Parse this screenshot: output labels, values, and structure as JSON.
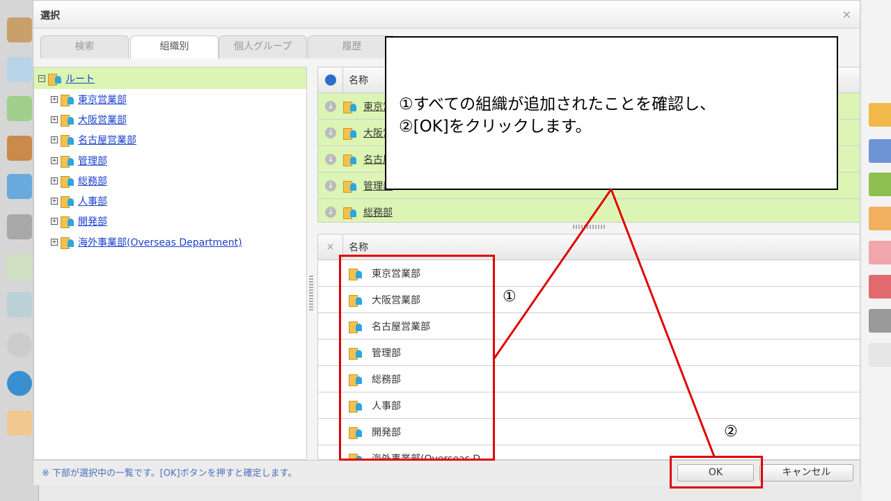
{
  "dialog": {
    "title": "選択",
    "close": "×"
  },
  "tabs": [
    {
      "label": "検索"
    },
    {
      "label": "組織別"
    },
    {
      "label": "個人グループ"
    },
    {
      "label": "履歴"
    }
  ],
  "tree": {
    "root": "ルート",
    "collapse": "−",
    "expand": "+",
    "nodes": [
      "東京営業部",
      "大阪営業部",
      "名古屋営業部",
      "管理部",
      "総務部",
      "人事部",
      "開発部",
      "海外事業部(Overseas Department)"
    ]
  },
  "upper_grid": {
    "header": "名称",
    "rows": [
      "東京営業部",
      "大阪営業部",
      "名古屋営業部",
      "管理部",
      "総務部"
    ]
  },
  "lower_grid": {
    "header": "名称",
    "remove": "×",
    "rows": [
      "東京営業部",
      "大阪営業部",
      "名古屋営業部",
      "管理部",
      "総務部",
      "人事部",
      "開発部",
      "海外事業部(Overseas D…"
    ]
  },
  "footer": {
    "text": "※ 下部が選択中の一覧です。[OK]ボタンを押すと確定します。",
    "ok": "OK",
    "cancel": "キャンセル"
  },
  "callout": {
    "line1": "①すべての組織が追加されたことを確認し、",
    "line2": "②[OK]をクリックします。"
  },
  "markers": {
    "m1": "①",
    "m2": "②"
  },
  "colors": {
    "highlight": "#e00000",
    "selected_row": "#dcf5b4",
    "link": "#1a3fcc"
  }
}
